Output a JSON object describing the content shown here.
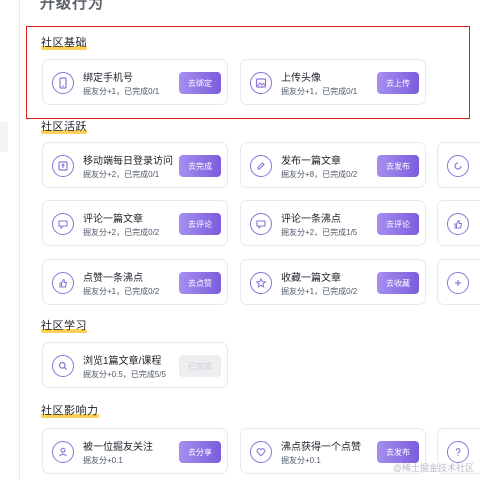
{
  "page": {
    "heading": "升级行为"
  },
  "watermark": "@稀土掘金技术社区",
  "sections": {
    "basic": {
      "title": "社区基础",
      "cards": [
        {
          "icon": "phone-icon",
          "title": "绑定手机号",
          "sub": "掘友分+1，已完成0/1",
          "button": "去绑定"
        },
        {
          "icon": "image-icon",
          "title": "上传头像",
          "sub": "掘友分+1，已完成0/1",
          "button": "去上传"
        }
      ]
    },
    "active": {
      "title": "社区活跃",
      "cards": [
        {
          "icon": "login-icon",
          "title": "移动端每日登录访问",
          "sub": "掘友分+2，已完成0/1",
          "button": "去完成"
        },
        {
          "icon": "edit-icon",
          "title": "发布一篇文章",
          "sub": "掘友分+8，已完成0/2",
          "button": "去发布"
        },
        {
          "icon": "comment-icon",
          "title": "评论一篇文章",
          "sub": "掘友分+2，已完成0/2",
          "button": "去评论"
        },
        {
          "icon": "comment-icon",
          "title": "评论一条沸点",
          "sub": "掘友分+2，已完成1/5",
          "button": "去评论"
        },
        {
          "icon": "thumb-up-icon",
          "title": "点赞一条沸点",
          "sub": "掘友分+1，已完成0/2",
          "button": "去点赞"
        },
        {
          "icon": "star-icon",
          "title": "收藏一篇文章",
          "sub": "掘友分+1，已完成0/2",
          "button": "去收藏"
        }
      ]
    },
    "learn": {
      "title": "社区学习",
      "cards": [
        {
          "icon": "search-icon",
          "title": "浏览1篇文章/课程",
          "sub": "掘友分+0.5，已完成5/5",
          "button": "已完成"
        }
      ]
    },
    "influence": {
      "title": "社区影响力",
      "cards": [
        {
          "icon": "user-icon",
          "title": "被一位掘友关注",
          "sub": "掘友分+0.1",
          "button": "去分享"
        },
        {
          "icon": "heart-icon",
          "title": "沸点获得一个点赞",
          "sub": "掘友分+0.1",
          "button": "去发布"
        }
      ]
    }
  },
  "colors": {
    "accent": "#8c74d6",
    "button_start": "#a58ff0",
    "button_end": "#7b5ddc",
    "highlight_border": "#e02424",
    "underline": "#ffc83a"
  }
}
